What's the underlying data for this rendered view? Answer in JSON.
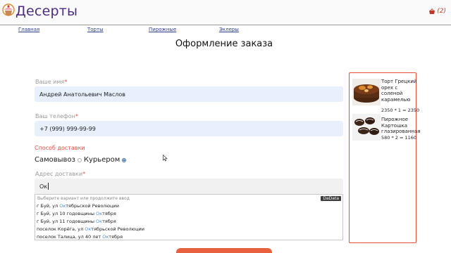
{
  "header": {
    "brand": "Десерты",
    "cart_count": "(2)",
    "brand_color": "#4b2d7f",
    "cart_color": "#c0392b"
  },
  "nav": {
    "items": [
      {
        "label": "Главная"
      },
      {
        "label": "Торты"
      },
      {
        "label": "Пирожные"
      },
      {
        "label": "Эклеры"
      }
    ]
  },
  "page": {
    "title": "Оформление заказа"
  },
  "form": {
    "name_label": "Ваше имя",
    "name_value": "Андрей Анатольевич Маслов",
    "phone_label": "Ваш телефон",
    "phone_value": "+7 (999) 999-99-99",
    "required_mark": "*",
    "delivery_title": "Способ доставки",
    "delivery_pickup": "Самовывоз",
    "delivery_courier": "Курьером",
    "delivery_selected": "Курьером",
    "address_label": "Адрес доставки",
    "address_value": "Ок"
  },
  "suggestions": {
    "hint": "Выберите вариант или продолжите ввод",
    "provider": "DaData",
    "items": [
      {
        "before": "г Буй, ул ",
        "match": "Ок",
        "after": "тябрьской Революции"
      },
      {
        "before": "г Буй, ул 10 годовщины ",
        "match": "Ок",
        "after": "тября"
      },
      {
        "before": "г Буй, ул 11 годовщины ",
        "match": "Ок",
        "after": "тября"
      },
      {
        "before": "поселок Корёга, ул ",
        "match": "Ок",
        "after": "тябрьской Революции"
      },
      {
        "before": "поселок Талица, ул 40 лет ",
        "match": "Ок",
        "after": "тября"
      }
    ]
  },
  "cart_items": [
    {
      "name": "Торт Грецкий орех с соленой карамелью",
      "price_line": "2350 * 1 = 2350"
    },
    {
      "name": "Пирожное Картошка глазированная",
      "price_line": "580 * 2 = 1160"
    }
  ],
  "colors": {
    "accent": "#e74c3c",
    "autofill_bg": "#e8f0fe",
    "submit_bg": "#e8603e"
  }
}
